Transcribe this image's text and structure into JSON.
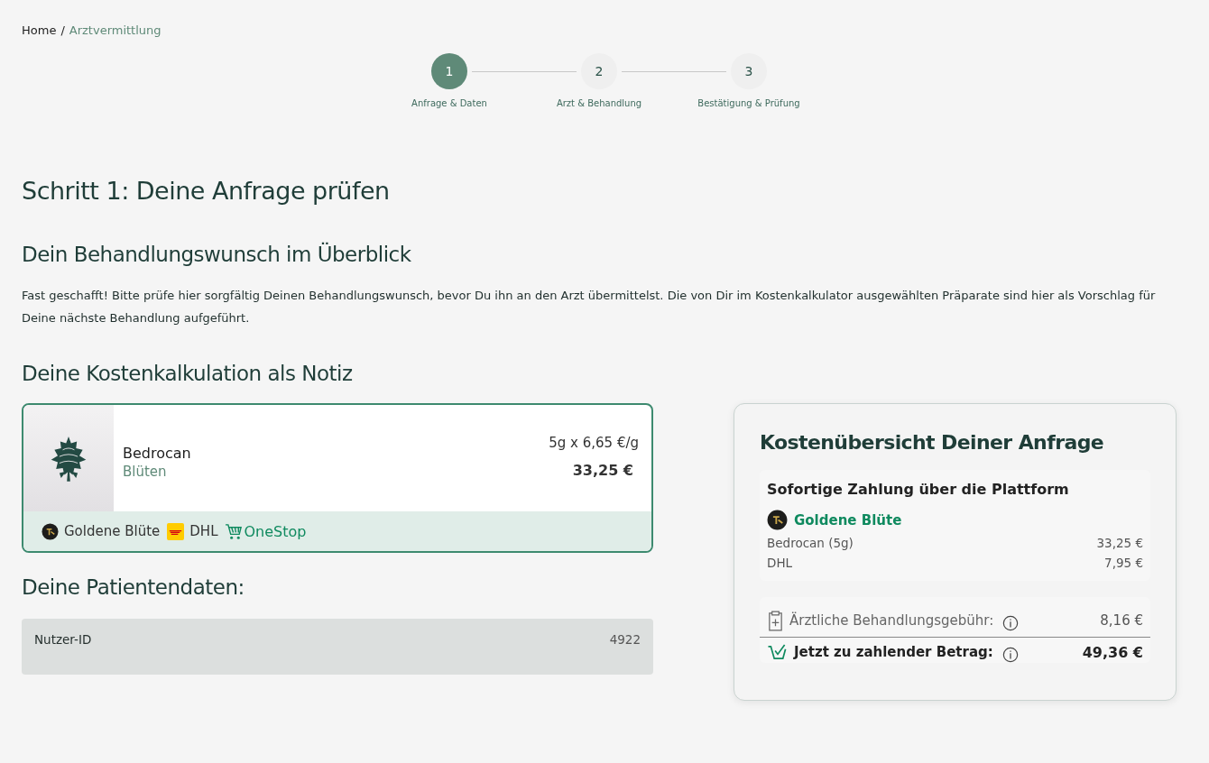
{
  "breadcrumb_separator": "/",
  "breadcrumb": [
    {
      "label": "Home",
      "current": false
    },
    {
      "label": "Arztvermittlung",
      "current": true
    }
  ],
  "steps": [
    {
      "number": "1",
      "label": "Anfrage & Daten",
      "selected": true
    },
    {
      "number": "2",
      "label": "Arzt & Behandlung",
      "selected": false
    },
    {
      "number": "3",
      "label": "Bestätigung & Prüfung",
      "selected": false
    }
  ],
  "title": "Schritt 1: Deine Anfrage prüfen",
  "section_title": "Dein Behandlungswunsch im Überblick",
  "intro": "Fast geschafft! Bitte prüfe hier sorgfältig Deinen Behandlungswunsch, bevor Du ihn an den Arzt übermittelst. Die von Dir im Kostenkalkulator ausgewählten Präparate sind hier als Vorschlag für Deine nächste Behandlung aufgeführt.",
  "notes_title": "Deine Kostenkalkulation als Notiz",
  "product": {
    "name": "Bedrocan",
    "category": "Blüten",
    "quantity_price": "5g x 6,65 €/g",
    "total": "33,25 €",
    "pharmacy": "Goldene Blüte",
    "shipping": "DHL",
    "marketplace": "OneStop"
  },
  "patient_title": "Deine Patientendaten:",
  "patient_fields": [
    {
      "label": "Nutzer-ID",
      "value": "4922"
    }
  ],
  "summary": {
    "title": "Kostenübersicht Deiner Anfrage",
    "immediate": {
      "title": "Sofortige Zahlung über die Plattform",
      "pharmacy": "Goldene Blüte",
      "lines": [
        {
          "label": "Bedrocan (5g)",
          "value": "33,25 €"
        },
        {
          "label": "DHL",
          "value": "7,95 €"
        }
      ]
    },
    "fee": {
      "label": "Ärztliche Behandlungsgebühr:",
      "value": "8,16 €"
    },
    "total": {
      "label": "Jetzt zu zahlender Betrag:",
      "value": "49,36 €"
    }
  }
}
